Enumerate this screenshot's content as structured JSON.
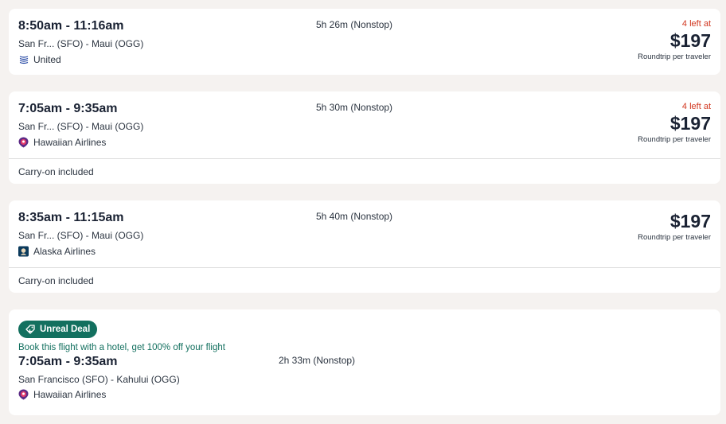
{
  "colors": {
    "page_bg": "#f5f2f0",
    "card_bg": "#ffffff",
    "urgency_red": "#d1361f",
    "deal_green": "#13705f"
  },
  "flights": [
    {
      "times": "8:50am - 11:16am",
      "route": "San Fr... (SFO) - Maui (OGG)",
      "airline": "United",
      "airline_icon": "united-logo-icon",
      "duration": "5h 26m (Nonstop)",
      "seats_left": "4 left at",
      "price": "$197",
      "price_note": "Roundtrip per traveler"
    },
    {
      "times": "7:05am - 9:35am",
      "route": "San Fr... (SFO) - Maui (OGG)",
      "airline": "Hawaiian Airlines",
      "airline_icon": "hawaiian-logo-icon",
      "duration": "5h 30m (Nonstop)",
      "seats_left": "4 left at",
      "price": "$197",
      "price_note": "Roundtrip per traveler",
      "footer": "Carry-on included"
    },
    {
      "times": "8:35am - 11:15am",
      "route": "San Fr... (SFO) - Maui (OGG)",
      "airline": "Alaska Airlines",
      "airline_icon": "alaska-logo-icon",
      "duration": "5h 40m (Nonstop)",
      "price": "$197",
      "price_note": "Roundtrip per traveler",
      "footer": "Carry-on included"
    },
    {
      "badge": "Unreal Deal",
      "deal_text": "Book this flight with a hotel, get 100% off your flight",
      "times": "7:05am - 9:35am",
      "route": "San Francisco (SFO) - Kahului (OGG)",
      "airline": "Hawaiian Airlines",
      "airline_icon": "hawaiian-logo-icon",
      "duration": "2h 33m (Nonstop)"
    }
  ]
}
